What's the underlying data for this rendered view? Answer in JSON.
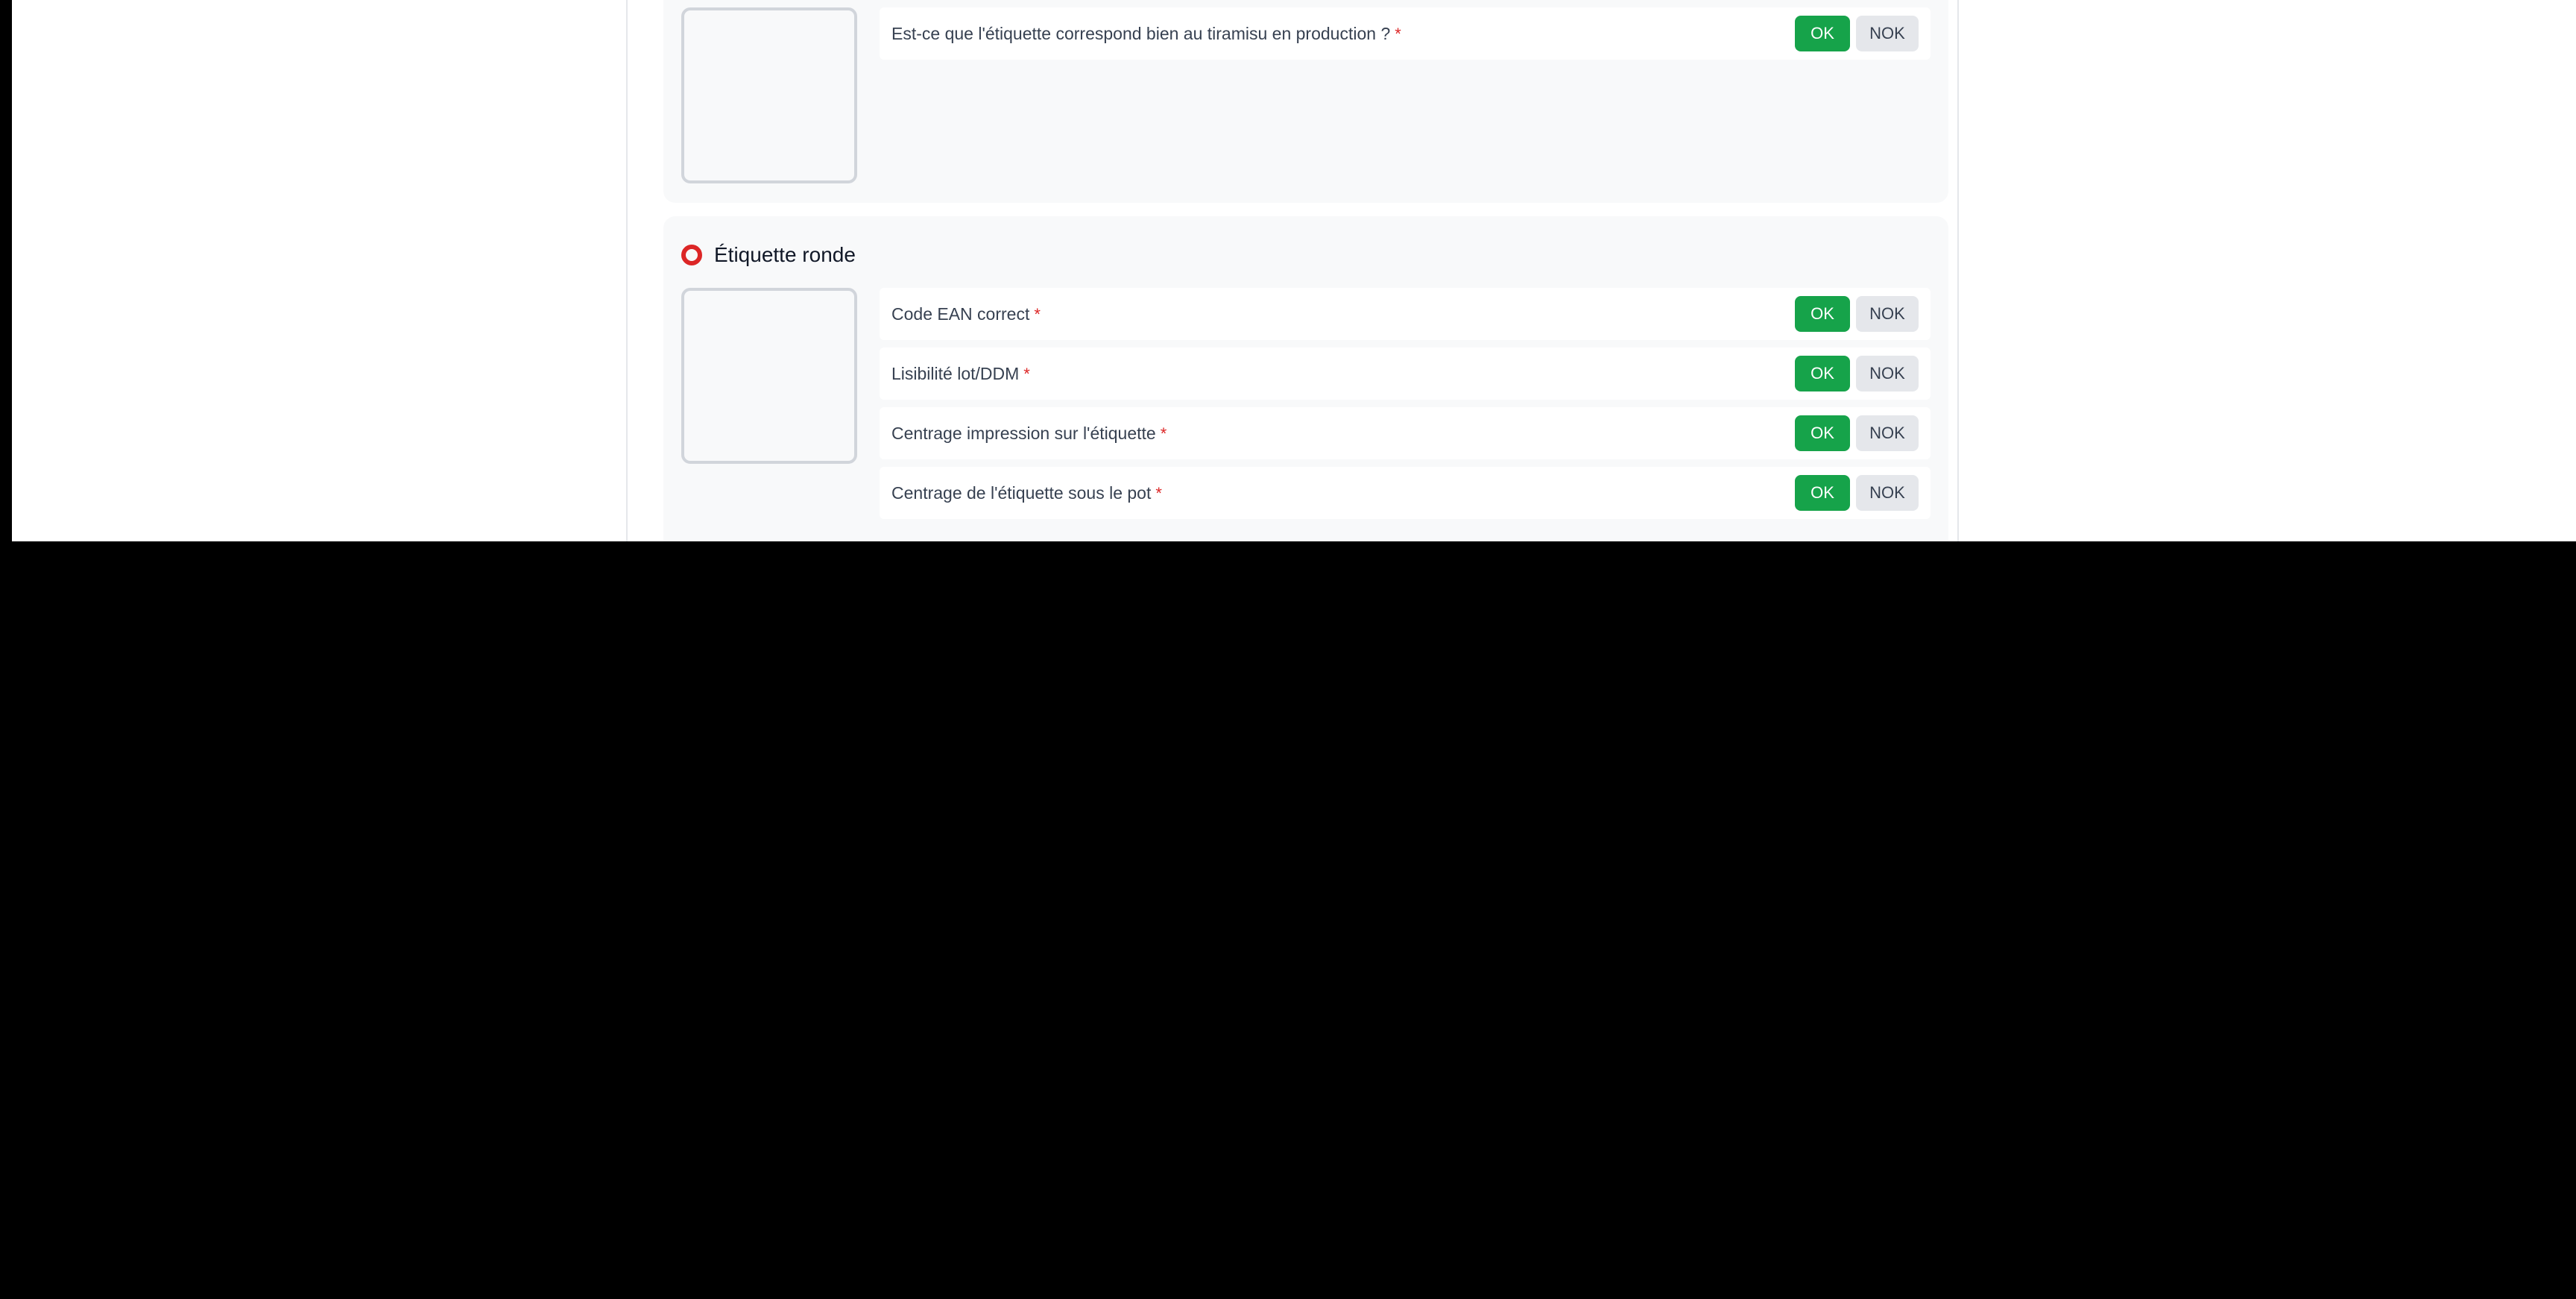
{
  "sections": [
    {
      "title": "",
      "questions": [
        {
          "text": "Est-ce que l'étiquette correspond bien au tiramisu en production ?",
          "required": "*",
          "ok_label": "OK",
          "nok_label": "NOK"
        }
      ]
    },
    {
      "title": "Étiquette ronde",
      "icon": "red-circle-icon",
      "icon_color": "#dc2626",
      "questions": [
        {
          "text": "Code EAN correct",
          "required": "*",
          "ok_label": "OK",
          "nok_label": "NOK"
        },
        {
          "text": "Lisibilité lot/DDM",
          "required": "*",
          "ok_label": "OK",
          "nok_label": "NOK"
        },
        {
          "text": "Centrage impression sur l'étiquette",
          "required": "*",
          "ok_label": "OK",
          "nok_label": "NOK"
        },
        {
          "text": "Centrage de l'étiquette sous le pot",
          "required": "*",
          "ok_label": "OK",
          "nok_label": "NOK"
        }
      ]
    }
  ],
  "colors": {
    "ok_button": "#16a34a",
    "nok_button": "#e5e7eb",
    "required": "#dc2626",
    "card_background": "#f8f9fa"
  }
}
